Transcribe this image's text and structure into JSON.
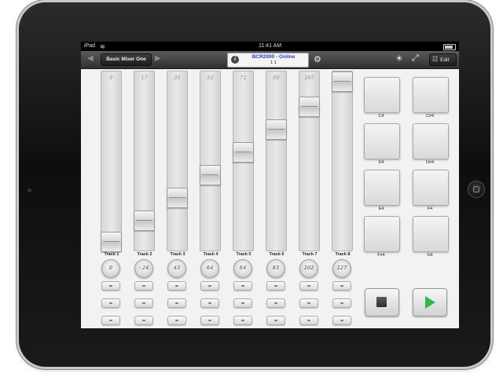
{
  "statusbar": {
    "carrier": "iPad",
    "time": "11:41 AM"
  },
  "toolbar": {
    "preset": "Basic Mixer One",
    "device_status": "BCR2000 - Online",
    "ports": "1  1",
    "edit_label": "Edit"
  },
  "tracks": [
    {
      "label": "Track 1",
      "fader": "0",
      "knob": "0",
      "level": 0
    },
    {
      "label": "Track 2",
      "fader": "17",
      "knob": "-24",
      "level": 17
    },
    {
      "label": "Track 3",
      "fader": "35",
      "knob": "43",
      "level": 35
    },
    {
      "label": "Track 4",
      "fader": "53",
      "knob": "64",
      "level": 53
    },
    {
      "label": "Track 5",
      "fader": "71",
      "knob": "64",
      "level": 71
    },
    {
      "label": "Track 6",
      "fader": "89",
      "knob": "83",
      "level": 89
    },
    {
      "label": "Track 7",
      "fader": "107",
      "knob": "102",
      "level": 107
    },
    {
      "label": "Track 8",
      "fader": "",
      "knob": "127",
      "level": 127
    }
  ],
  "fader_max": 127,
  "pads": [
    {
      "label": "C4"
    },
    {
      "label": "C#4"
    },
    {
      "label": "D4"
    },
    {
      "label": "D#4"
    },
    {
      "label": "E4"
    },
    {
      "label": "F4"
    },
    {
      "label": "F#4"
    },
    {
      "label": "G4"
    }
  ],
  "colors": {
    "status_text": "#1a3fd8",
    "play": "#2fb84a",
    "toolbar": "#3f3f3f"
  },
  "icons": {
    "info": "i",
    "gear": "⚙",
    "brightness": "☀",
    "expand": "⤢",
    "mixer": "☷",
    "prev": "◀",
    "next": "▶"
  }
}
